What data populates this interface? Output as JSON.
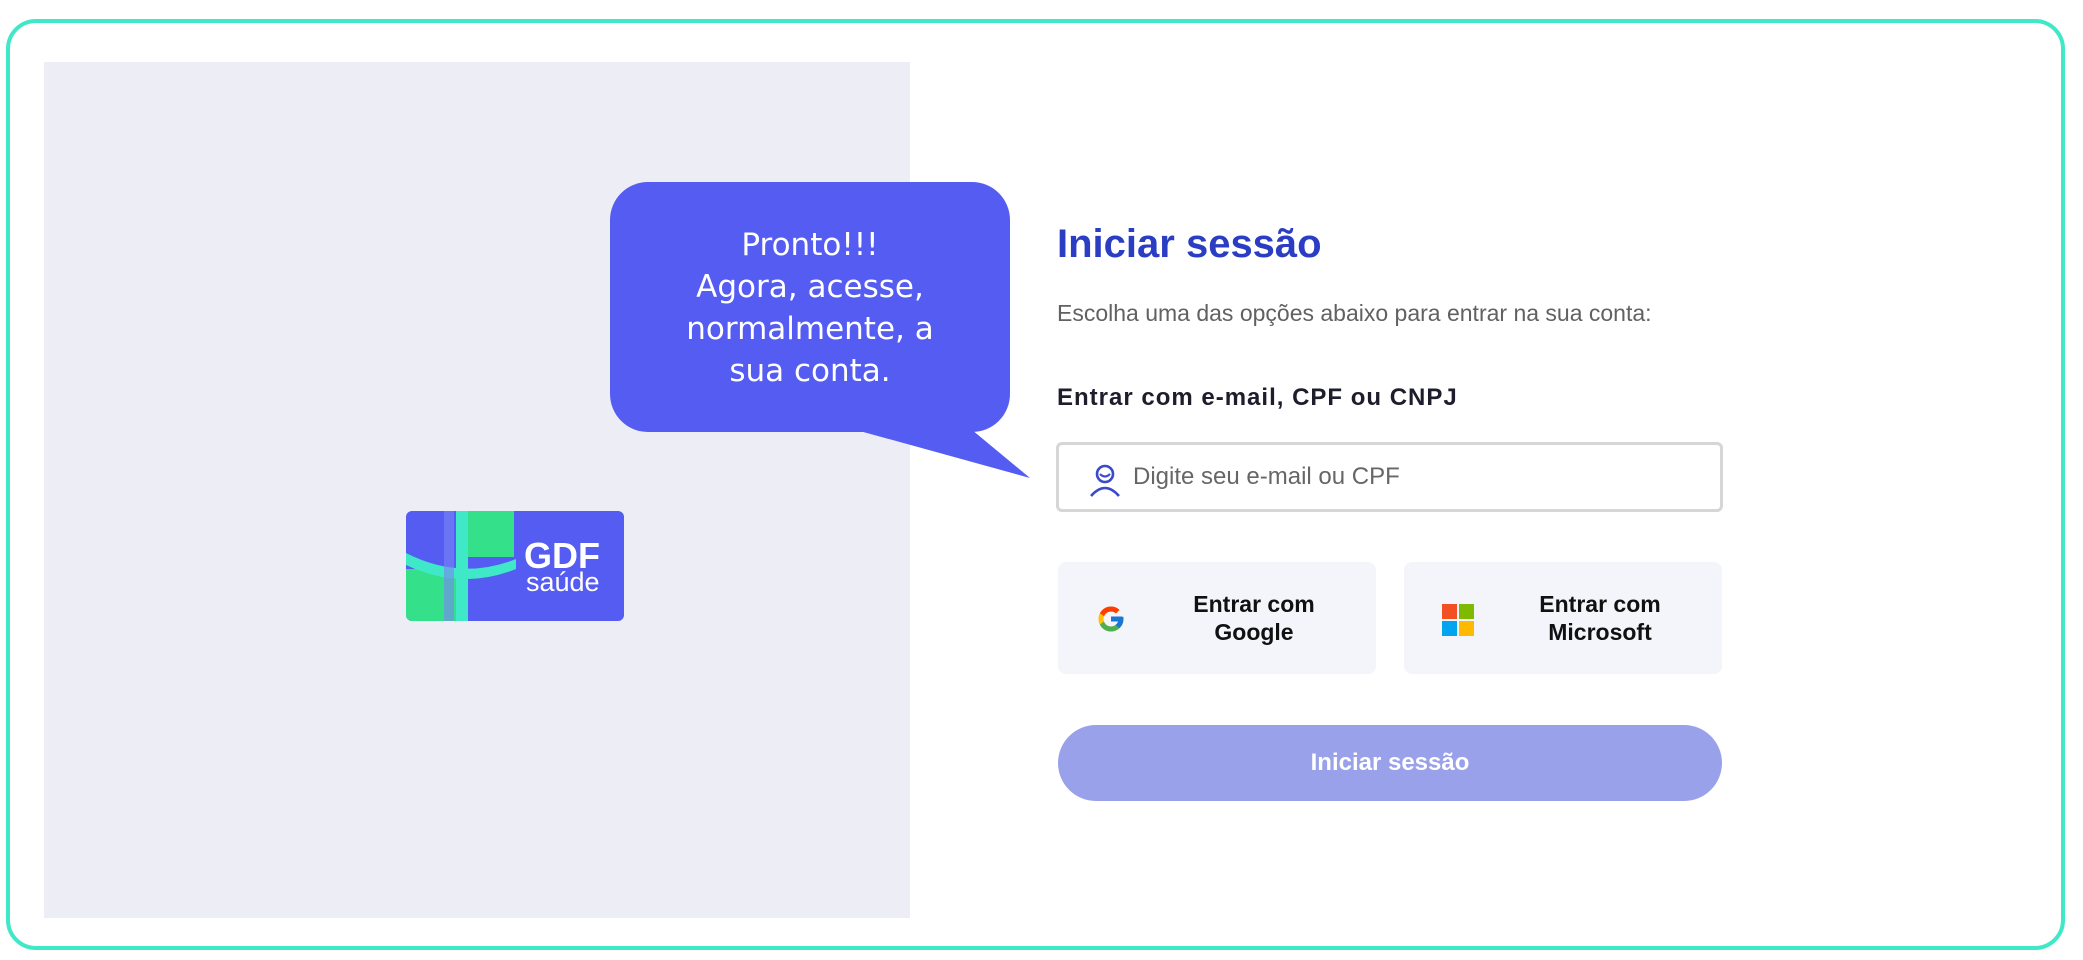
{
  "brand": {
    "logo_text": "GDF",
    "logo_subtext": "saúde"
  },
  "callout": {
    "lines": [
      "Pronto!!!",
      "Agora, acesse,",
      "normalmente, a",
      "sua conta."
    ]
  },
  "login": {
    "title": "Iniciar sessão",
    "subtitle": "Escolha uma das opções abaixo para entrar na sua conta:",
    "field_label": "Entrar com e-mail, CPF ou CNPJ",
    "input_placeholder": "Digite seu e-mail ou CPF",
    "input_icon": "user-icon",
    "google_button": {
      "line1": "Entrar com",
      "line2": "Google",
      "icon": "google-icon"
    },
    "microsoft_button": {
      "line1": "Entrar com",
      "line2": "Microsoft",
      "icon": "microsoft-icon"
    },
    "submit_label": "Iniciar sessão"
  },
  "colors": {
    "frame_border": "#3fe8c6",
    "accent": "#545cf2",
    "title": "#2b3ec3",
    "submit_disabled": "#98a1ea",
    "left_panel_bg": "#ededf6"
  }
}
